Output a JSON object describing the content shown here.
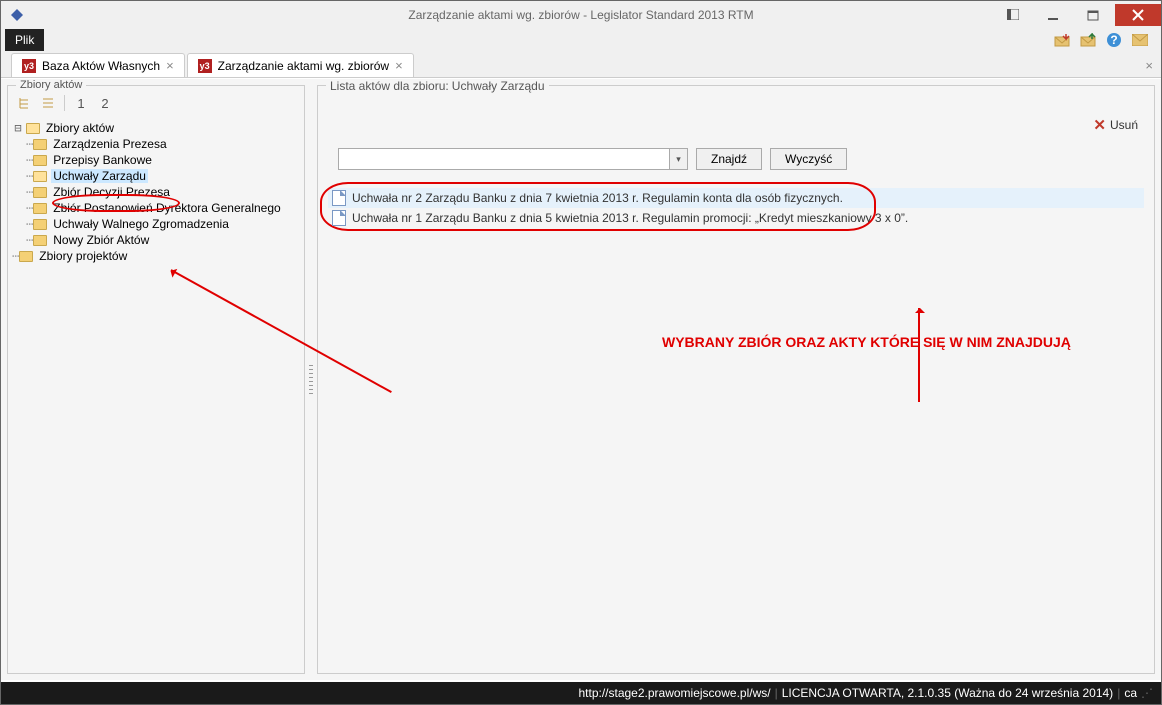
{
  "window": {
    "title": "Zarządzanie aktami wg. zbiorów - Legislator Standard 2013 RTM"
  },
  "menubar": {
    "file": "Plik"
  },
  "tabs": {
    "items": [
      {
        "label": "Baza Aktów Własnych"
      },
      {
        "label": "Zarządzanie aktami wg. zbiorów"
      }
    ]
  },
  "left_panel": {
    "title": "Zbiory aktów",
    "toolbar": {
      "btn1": "1",
      "btn2": "2"
    },
    "tree": {
      "root": "Zbiory aktów",
      "children": [
        "Zarządzenia Prezesa",
        "Przepisy Bankowe",
        "Uchwały Zarządu",
        "Zbiór Decyzji Prezesa",
        "Zbiór Postanowień Dyrektora Generalnego",
        "Uchwały Walnego Zgromadzenia",
        "Nowy Zbiór Aktów"
      ],
      "sibling": "Zbiory projektów"
    }
  },
  "right_panel": {
    "title_prefix": "Lista aktów dla zbioru:",
    "title_value": "Uchwały Zarządu",
    "delete_label": "Usuń",
    "search": {
      "find_label": "Znajdź",
      "clear_label": "Wyczyść"
    },
    "list": [
      "Uchwała nr 2 Zarządu Banku z dnia 7 kwietnia 2013 r. Regulamin konta dla osób fizycznych.",
      "Uchwała nr 1 Zarządu Banku z dnia 5 kwietnia 2013 r. Regulamin promocji: „Kredyt mieszkaniowy 3 x 0”."
    ]
  },
  "annotation": {
    "text": "WYBRANY ZBIÓR ORAZ AKTY KTÓRE SIĘ W NIM ZNAJDUJĄ"
  },
  "statusbar": {
    "url": "http://stage2.prawomiejscowe.pl/ws/",
    "license": "LICENCJA OTWARTA, 2.1.0.35 (Ważna do 24 września 2014)",
    "mode": "ca"
  }
}
